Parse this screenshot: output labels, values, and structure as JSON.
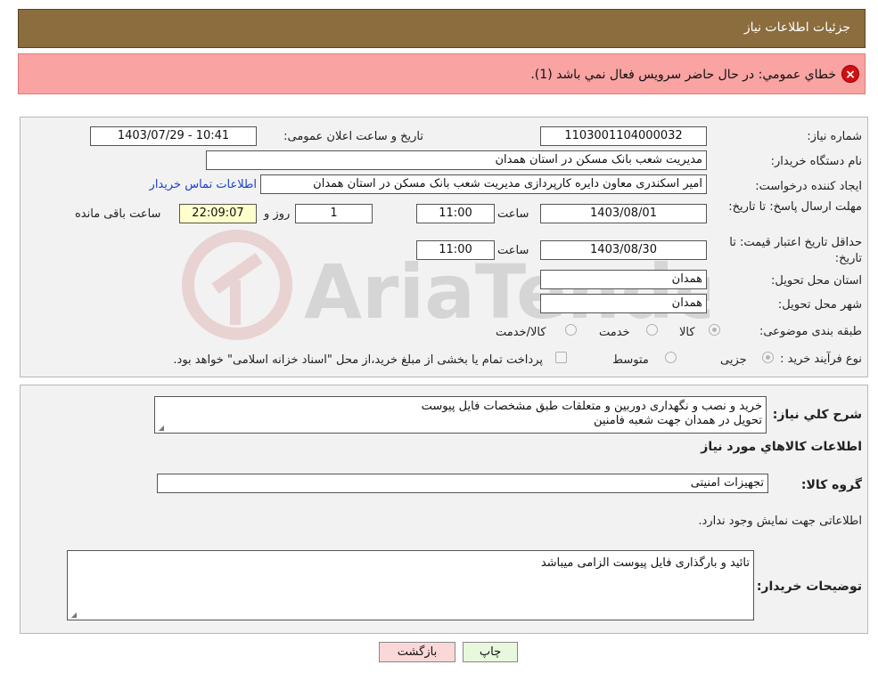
{
  "header": {
    "title": "جزئیات اطلاعات نیاز"
  },
  "error": {
    "message": "خطاي عمومي: در حال حاضر سرويس فعال نمي باشد (1)."
  },
  "watermark": {
    "text": "AriaTender.neT"
  },
  "form": {
    "need_number_label": "شماره نیاز:",
    "need_number_value": "1103001104000032",
    "announce_label": "تاریخ و ساعت اعلان عمومی:",
    "announce_value": "1403/07/29 - 10:41",
    "buyer_label": "نام دستگاه خریدار:",
    "buyer_value": "مدیریت شعب بانک مسکن در استان همدان",
    "creator_label": "ایجاد کننده درخواست:",
    "creator_value": "امیر اسکندری معاون دایره کارپردازی مدیریت شعب بانک مسکن در استان همدان",
    "contact_link": "اطلاعات تماس خریدار",
    "deadline_label": "مهلت ارسال پاسخ: تا تاریخ:",
    "deadline_date": "1403/08/01",
    "time_label": "ساعت",
    "deadline_time": "11:00",
    "days_value": "1",
    "days_label": "روز و",
    "remaining_value": "22:09:07",
    "remaining_label": "ساعت باقی مانده",
    "validity_label": "حداقل تاریخ اعتبار قیمت: تا تاریخ:",
    "validity_date": "1403/08/30",
    "validity_time": "11:00",
    "province_label": "استان محل تحویل:",
    "province_value": "همدان",
    "city_label": "شهر محل تحویل:",
    "city_value": "همدان",
    "category_label": "طبقه بندی موضوعی:",
    "category_options": [
      "کالا",
      "خدمت",
      "کالا/خدمت"
    ],
    "process_label": "نوع فرآیند خرید :",
    "process_options": [
      "جزیی",
      "متوسط"
    ],
    "payment_note": "پرداخت تمام یا بخشی از مبلغ خرید،از محل \"اسناد خزانه اسلامی\" خواهد بود."
  },
  "details": {
    "summary_label": "شرح کلي نياز:",
    "summary_line1": "خرید و نصب و نگهداری دوربین و متعلقات طبق مشخصات فایل پیوست",
    "summary_line2": "تحویل در همدان جهت شعبه فامنین",
    "goods_heading": "اطلاعات کالاهاي مورد نياز",
    "group_label": "گروه کالا:",
    "group_value": "تجهیزات امنیتی",
    "no_data": "اطلاعاتی جهت نمایش وجود ندارد.",
    "buyer_notes_label": "توضیحات خریدار:",
    "buyer_notes_value": "تائید و بارگذاری فایل پیوست الزامی میباشد"
  },
  "buttons": {
    "print": "چاپ",
    "back": "بازگشت"
  },
  "colors": {
    "header_bg": "#8b6d3e",
    "error_bg": "#f9a3a3",
    "panel_bg": "#f2f2f2",
    "link": "#1a3fd0"
  }
}
